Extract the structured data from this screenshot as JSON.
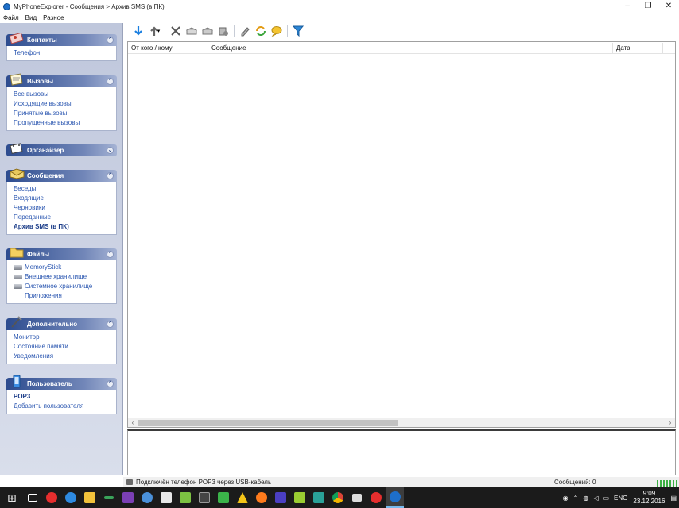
{
  "window": {
    "title": "MyPhoneExplorer -  Сообщения > Архив SMS (в ПК)"
  },
  "menu": [
    "Файл",
    "Вид",
    "Разное"
  ],
  "sidebar": {
    "groups": [
      {
        "title": "Контакты",
        "icon": "contacts-card-icon",
        "items": [
          "Телефон"
        ]
      },
      {
        "title": "Вызовы",
        "icon": "calls-notepad-icon",
        "items": [
          "Все вызовы",
          "Исходящие вызовы",
          "Принятые вызовы",
          "Пропущенные вызовы"
        ]
      },
      {
        "title": "Органайзер",
        "icon": "organizer-calendar-icon",
        "items": []
      },
      {
        "title": "Сообщения",
        "icon": "messages-envelope-icon",
        "items": [
          "Беседы",
          "Входящие",
          "Черновики",
          "Переданные",
          "Архив SMS (в ПК)"
        ],
        "active": "Архив SMS (в ПК)"
      },
      {
        "title": "Файлы",
        "icon": "files-folder-icon",
        "items": [
          "MemoryStick",
          "Внешнее хранилище",
          "Системное хранилище",
          "Приложения"
        ]
      },
      {
        "title": "Дополнительно",
        "icon": "extra-tools-icon",
        "items": [
          "Монитор",
          "Состояние памяти",
          "Уведомления"
        ]
      },
      {
        "title": "Пользователь",
        "icon": "user-phone-icon",
        "items": [
          "POP3",
          "Добавить пользователя"
        ]
      }
    ]
  },
  "toolbar": {
    "buttons": [
      "download-arrow-icon",
      "upload-arrow-icon",
      "delete-x-icon",
      "reply-icon",
      "forward-icon",
      "export-icon",
      "edit-pen-icon",
      "refresh-sync-icon",
      "chat-bubble-icon",
      "filter-funnel-icon"
    ]
  },
  "list": {
    "columns": [
      "От кого / кому",
      "Сообщение",
      "Дата"
    ],
    "rows": []
  },
  "status": {
    "connection": "Подключён телефон POP3 через USB-кабель",
    "count": "Сообщений: 0"
  },
  "taskbar": {
    "lang": "ENG",
    "time": "9:09",
    "date": "23.12.2016"
  },
  "colors": {
    "sidebar_header": "#2d4c8f",
    "link": "#2a56b0",
    "taskbar": "#1b1b1b"
  }
}
